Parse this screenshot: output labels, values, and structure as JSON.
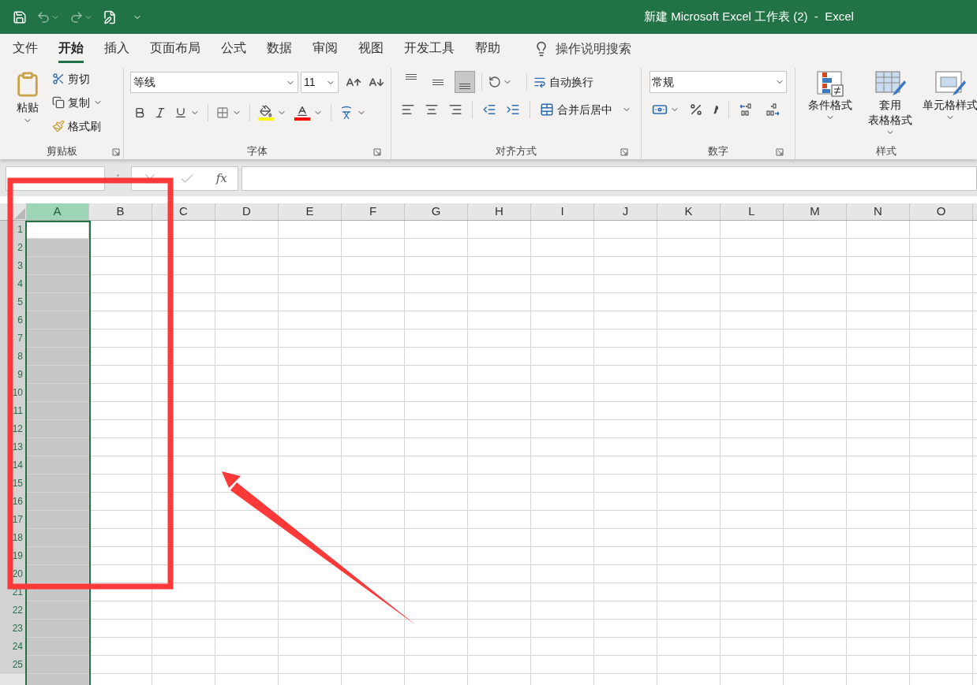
{
  "window": {
    "title": "新建 Microsoft Excel 工作表 (2)  -  Excel"
  },
  "menu_tabs": [
    {
      "label": "文件",
      "selected": false
    },
    {
      "label": "开始",
      "selected": true
    },
    {
      "label": "插入",
      "selected": false
    },
    {
      "label": "页面布局",
      "selected": false
    },
    {
      "label": "公式",
      "selected": false
    },
    {
      "label": "数据",
      "selected": false
    },
    {
      "label": "审阅",
      "selected": false
    },
    {
      "label": "视图",
      "selected": false
    },
    {
      "label": "开发工具",
      "selected": false
    },
    {
      "label": "帮助",
      "selected": false
    }
  ],
  "tell_me": "操作说明搜索",
  "clipboard": {
    "paste": "粘贴",
    "cut": "剪切",
    "copy": "复制",
    "format_painter": "格式刷",
    "label": "剪贴板"
  },
  "font": {
    "name": "等线",
    "size": "11",
    "label": "字体"
  },
  "alignment": {
    "vertical_align": [
      {
        "selected": false
      },
      {
        "selected": false
      },
      {
        "selected": true
      }
    ],
    "wrap_text": "自动换行",
    "merge_center": "合并后居中",
    "label": "对齐方式"
  },
  "number": {
    "format": "常规",
    "label": "数字"
  },
  "styles": {
    "buttons": [
      {
        "kind": "conditional",
        "lines": [
          "条件格式"
        ]
      },
      {
        "kind": "table",
        "lines": [
          "套用",
          "表格格式"
        ]
      },
      {
        "kind": "cell",
        "lines": [
          "单元格样式"
        ]
      }
    ],
    "label": "样式"
  },
  "formula_bar": {
    "fx_label": "fx"
  },
  "sheet": {
    "columns": [
      {
        "label": "A",
        "selected": true
      },
      {
        "label": "B",
        "selected": false
      },
      {
        "label": "C",
        "selected": false
      },
      {
        "label": "D",
        "selected": false
      },
      {
        "label": "E",
        "selected": false
      },
      {
        "label": "F",
        "selected": false
      },
      {
        "label": "G",
        "selected": false
      },
      {
        "label": "H",
        "selected": false
      },
      {
        "label": "I",
        "selected": false
      },
      {
        "label": "J",
        "selected": false
      },
      {
        "label": "K",
        "selected": false
      },
      {
        "label": "L",
        "selected": false
      },
      {
        "label": "M",
        "selected": false
      },
      {
        "label": "N",
        "selected": false
      },
      {
        "label": "O",
        "selected": false
      }
    ],
    "rows": [
      {
        "label": "1",
        "selected": true,
        "active": true
      },
      {
        "label": "2",
        "selected": true,
        "active": false
      },
      {
        "label": "3",
        "selected": true,
        "active": false
      },
      {
        "label": "4",
        "selected": true,
        "active": false
      },
      {
        "label": "5",
        "selected": true,
        "active": false
      },
      {
        "label": "6",
        "selected": true,
        "active": false
      },
      {
        "label": "7",
        "selected": true,
        "active": false
      },
      {
        "label": "8",
        "selected": true,
        "active": false
      },
      {
        "label": "9",
        "selected": true,
        "active": false
      },
      {
        "label": "10",
        "selected": true,
        "active": false
      },
      {
        "label": "11",
        "selected": true,
        "active": false
      },
      {
        "label": "12",
        "selected": true,
        "active": false
      },
      {
        "label": "13",
        "selected": true,
        "active": false
      },
      {
        "label": "14",
        "selected": true,
        "active": false
      },
      {
        "label": "15",
        "selected": true,
        "active": false
      },
      {
        "label": "16",
        "selected": true,
        "active": false
      },
      {
        "label": "17",
        "selected": true,
        "active": false
      },
      {
        "label": "18",
        "selected": true,
        "active": false
      },
      {
        "label": "19",
        "selected": true,
        "active": false
      },
      {
        "label": "20",
        "selected": true,
        "active": false
      },
      {
        "label": "21",
        "selected": true,
        "active": false
      },
      {
        "label": "22",
        "selected": true,
        "active": false
      },
      {
        "label": "23",
        "selected": true,
        "active": false
      },
      {
        "label": "24",
        "selected": true,
        "active": false
      },
      {
        "label": "25",
        "selected": true,
        "active": false
      }
    ]
  }
}
